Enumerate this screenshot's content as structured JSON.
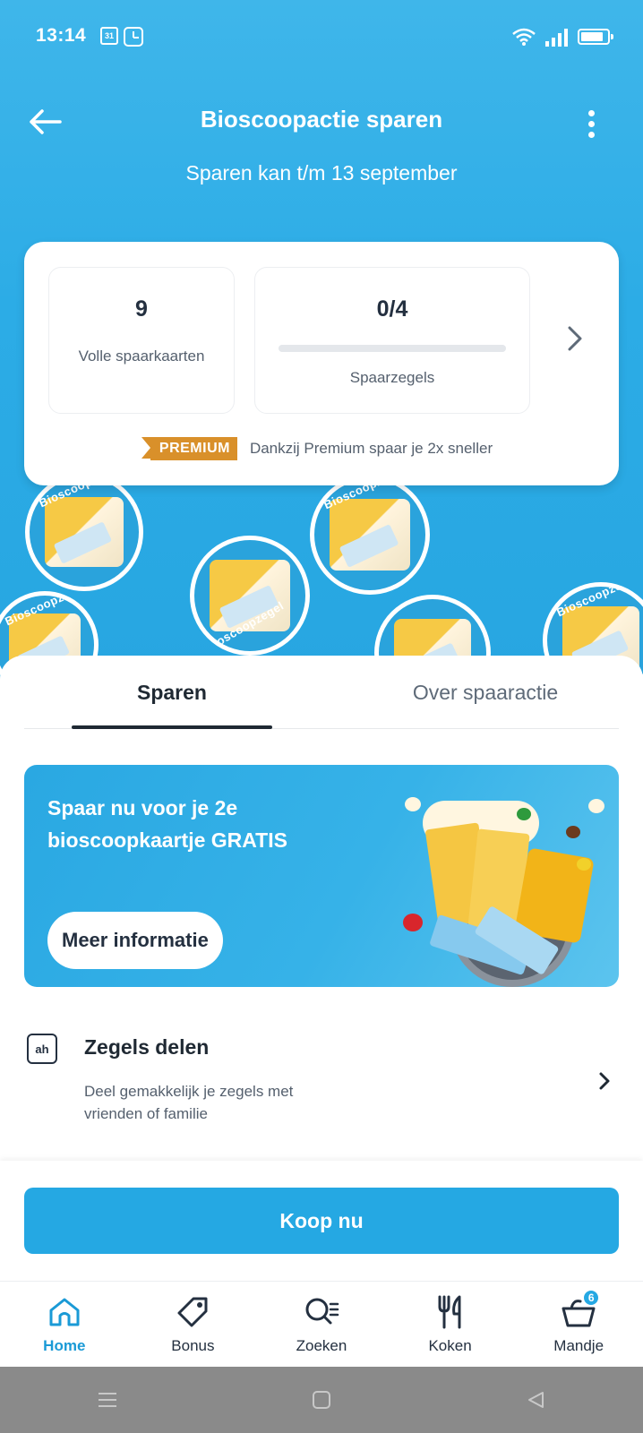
{
  "status_bar": {
    "time": "13:14",
    "calendar_day": "31",
    "icons": [
      "calendar-icon",
      "clock-icon",
      "wifi-icon",
      "signal-icon",
      "battery-icon"
    ]
  },
  "header": {
    "title": "Bioscoopactie sparen",
    "subtitle": "Sparen kan t/m 13 september",
    "back_icon": "arrow-left-icon",
    "menu_icon": "more-vertical-icon"
  },
  "stats": {
    "full_cards_value": "9",
    "full_cards_label": "Volle spaarkaarten",
    "stamps_value": "0/4",
    "stamps_progress": 0,
    "stamps_label": "Spaarzegels",
    "premium_badge": "PREMIUM",
    "premium_text": "Dankzij Premium spaar je 2x sneller"
  },
  "stamp_decoration": {
    "text": "Bioscoopzegel"
  },
  "tabs": [
    {
      "label": "Sparen",
      "active": true
    },
    {
      "label": "Over spaaractie",
      "active": false
    }
  ],
  "promo": {
    "text": "Spaar nu voor je 2e bioscoopkaartje GRATIS",
    "button_label": "Meer informatie"
  },
  "share": {
    "icon_text": "ah",
    "title": "Zegels delen",
    "description": "Deel gemakkelijk je zegels met vrienden of familie"
  },
  "buy": {
    "button_label": "Koop nu"
  },
  "colors": {
    "brand_blue": "#25a8e3",
    "premium_orange": "#d9902a",
    "text_dark": "#1f2933"
  },
  "bottom_nav": {
    "items": [
      {
        "label": "Home",
        "icon": "home-icon",
        "active": true
      },
      {
        "label": "Bonus",
        "icon": "tag-icon",
        "active": false
      },
      {
        "label": "Zoeken",
        "icon": "search-icon",
        "active": false
      },
      {
        "label": "Koken",
        "icon": "fork-knife-icon",
        "active": false
      },
      {
        "label": "Mandje",
        "icon": "basket-icon",
        "active": false,
        "badge": "6"
      }
    ]
  }
}
